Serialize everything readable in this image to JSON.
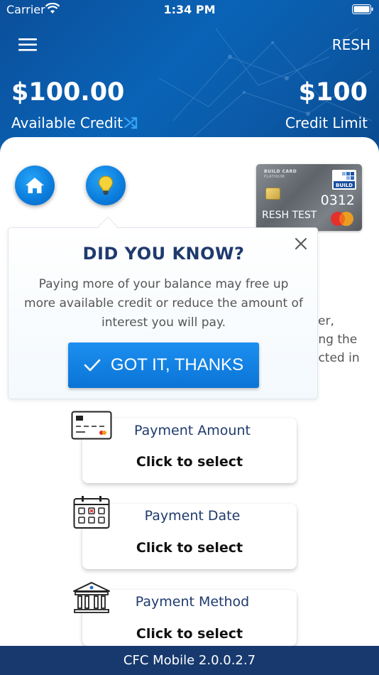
{
  "status_bar": {
    "carrier": "Carrier",
    "time": "1:34 PM"
  },
  "header": {
    "user_name": "RESH",
    "available_amount": "$100.00",
    "available_label": "Available Credit",
    "limit_amount": "$100",
    "limit_label": "Credit Limit"
  },
  "card": {
    "brand": "BUILD CARD",
    "tier": "PLATINUM",
    "logo_text": "BUILD",
    "last_four": "0312",
    "holder": "RESH TEST"
  },
  "background_text": {
    "line1": "ver,",
    "line2": "ong the",
    "line3": "ected in"
  },
  "popover": {
    "title": "DID YOU KNOW?",
    "body": "Paying more of your balance may free up more available credit or reduce the amount of interest you will pay.",
    "button_label": "GOT IT, THANKS"
  },
  "payment": {
    "amount": {
      "label": "Payment Amount",
      "value": "Click to select"
    },
    "date": {
      "label": "Payment Date",
      "value": "Click to select"
    },
    "method": {
      "label": "Payment Method",
      "value": "Click to select"
    }
  },
  "footer": {
    "version": "CFC Mobile 2.0.0.2.7"
  },
  "colors": {
    "brand_blue": "#0b5aa8",
    "navy": "#17396e",
    "title_navy": "#1f3a6e",
    "button_blue": "#0a74d6"
  }
}
